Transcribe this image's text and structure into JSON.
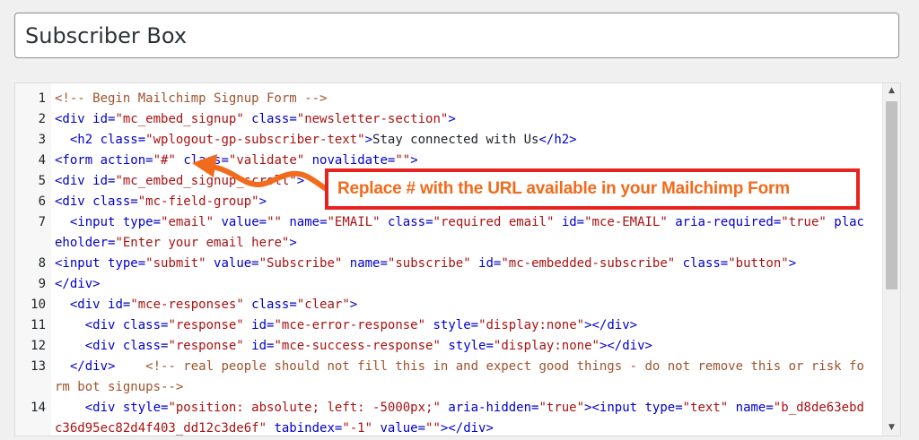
{
  "title_input": {
    "value": "Subscriber Box"
  },
  "editor": {
    "lines": [
      {
        "num": "1",
        "tokens": [
          {
            "c": "cmt",
            "t": "<!-- Begin Mailchimp Signup Form -->"
          }
        ]
      },
      {
        "num": "2",
        "tokens": [
          {
            "c": "tag",
            "t": "<div "
          },
          {
            "c": "attr",
            "t": "id="
          },
          {
            "c": "str",
            "t": "\"mc_embed_signup\""
          },
          {
            "c": "attr",
            "t": " class="
          },
          {
            "c": "str",
            "t": "\"newsletter-section\""
          },
          {
            "c": "tag",
            "t": ">"
          }
        ]
      },
      {
        "num": "3",
        "tokens": [
          {
            "c": "tag",
            "t": "  <h2 "
          },
          {
            "c": "attr",
            "t": "class="
          },
          {
            "c": "str",
            "t": "\"wplogout-gp-subscriber-text\""
          },
          {
            "c": "tag",
            "t": ">"
          },
          {
            "c": "text",
            "t": "Stay connected with Us"
          },
          {
            "c": "tag",
            "t": "</h2>"
          }
        ]
      },
      {
        "num": "4",
        "tokens": [
          {
            "c": "tag",
            "t": "<form "
          },
          {
            "c": "attr",
            "t": "action="
          },
          {
            "c": "str",
            "t": "\"#\""
          },
          {
            "c": "attr",
            "t": " class="
          },
          {
            "c": "str",
            "t": "\"validate\""
          },
          {
            "c": "attr",
            "t": " novalidate="
          },
          {
            "c": "str",
            "t": "\"\""
          },
          {
            "c": "tag",
            "t": ">"
          }
        ]
      },
      {
        "num": "5",
        "tokens": [
          {
            "c": "tag",
            "t": "<div "
          },
          {
            "c": "attr",
            "t": "id="
          },
          {
            "c": "str",
            "t": "\"mc_embed_signup_scroll\""
          },
          {
            "c": "tag",
            "t": ">"
          }
        ]
      },
      {
        "num": "6",
        "tokens": [
          {
            "c": "tag",
            "t": "<div "
          },
          {
            "c": "attr",
            "t": "class="
          },
          {
            "c": "str",
            "t": "\"mc-field-group\""
          },
          {
            "c": "tag",
            "t": ">"
          }
        ]
      },
      {
        "num": "7",
        "tokens": [
          {
            "c": "tag",
            "t": "  <input "
          },
          {
            "c": "attr",
            "t": "type="
          },
          {
            "c": "str",
            "t": "\"email\""
          },
          {
            "c": "attr",
            "t": " value="
          },
          {
            "c": "str",
            "t": "\"\""
          },
          {
            "c": "attr",
            "t": " name="
          },
          {
            "c": "str",
            "t": "\"EMAIL\""
          },
          {
            "c": "attr",
            "t": " class="
          },
          {
            "c": "str",
            "t": "\"required email\""
          },
          {
            "c": "attr",
            "t": " id="
          },
          {
            "c": "str",
            "t": "\"mce-EMAIL\""
          },
          {
            "c": "attr",
            "t": " aria-required="
          },
          {
            "c": "str",
            "t": "\"true\""
          },
          {
            "c": "attr",
            "t": " placeholder="
          },
          {
            "c": "str",
            "t": "\"Enter your email here\""
          },
          {
            "c": "tag",
            "t": ">"
          }
        ]
      },
      {
        "num": "8",
        "tokens": [
          {
            "c": "tag",
            "t": "<input "
          },
          {
            "c": "attr",
            "t": "type="
          },
          {
            "c": "str",
            "t": "\"submit\""
          },
          {
            "c": "attr",
            "t": " value="
          },
          {
            "c": "str",
            "t": "\"Subscribe\""
          },
          {
            "c": "attr",
            "t": " name="
          },
          {
            "c": "str",
            "t": "\"subscribe\""
          },
          {
            "c": "attr",
            "t": " id="
          },
          {
            "c": "str",
            "t": "\"mc-embedded-subscribe\""
          },
          {
            "c": "attr",
            "t": " class="
          },
          {
            "c": "str",
            "t": "\"button\""
          },
          {
            "c": "tag",
            "t": ">"
          }
        ]
      },
      {
        "num": "9",
        "tokens": [
          {
            "c": "tag",
            "t": "</div>"
          }
        ]
      },
      {
        "num": "10",
        "tokens": [
          {
            "c": "tag",
            "t": "  <div "
          },
          {
            "c": "attr",
            "t": "id="
          },
          {
            "c": "str",
            "t": "\"mce-responses\""
          },
          {
            "c": "attr",
            "t": " class="
          },
          {
            "c": "str",
            "t": "\"clear\""
          },
          {
            "c": "tag",
            "t": ">"
          }
        ]
      },
      {
        "num": "11",
        "tokens": [
          {
            "c": "tag",
            "t": "    <div "
          },
          {
            "c": "attr",
            "t": "class="
          },
          {
            "c": "str",
            "t": "\"response\""
          },
          {
            "c": "attr",
            "t": " id="
          },
          {
            "c": "str",
            "t": "\"mce-error-response\""
          },
          {
            "c": "attr",
            "t": " style="
          },
          {
            "c": "str",
            "t": "\"display:none\""
          },
          {
            "c": "tag",
            "t": "></div>"
          }
        ]
      },
      {
        "num": "12",
        "tokens": [
          {
            "c": "tag",
            "t": "    <div "
          },
          {
            "c": "attr",
            "t": "class="
          },
          {
            "c": "str",
            "t": "\"response\""
          },
          {
            "c": "attr",
            "t": " id="
          },
          {
            "c": "str",
            "t": "\"mce-success-response\""
          },
          {
            "c": "attr",
            "t": " style="
          },
          {
            "c": "str",
            "t": "\"display:none\""
          },
          {
            "c": "tag",
            "t": "></div>"
          }
        ]
      },
      {
        "num": "13",
        "tokens": [
          {
            "c": "tag",
            "t": "  </div>"
          },
          {
            "c": "text",
            "t": "    "
          },
          {
            "c": "cmt",
            "t": "<!-- real people should not fill this in and expect good things - do not remove this or risk form bot signups-->"
          }
        ]
      },
      {
        "num": "14",
        "tokens": [
          {
            "c": "tag",
            "t": "    <div "
          },
          {
            "c": "attr",
            "t": "style="
          },
          {
            "c": "str",
            "t": "\"position: absolute; left: -5000px;\""
          },
          {
            "c": "attr",
            "t": " aria-hidden="
          },
          {
            "c": "str",
            "t": "\"true\""
          },
          {
            "c": "tag",
            "t": "><input "
          },
          {
            "c": "attr",
            "t": "type="
          },
          {
            "c": "str",
            "t": "\"text\""
          },
          {
            "c": "attr",
            "t": " name="
          },
          {
            "c": "str",
            "t": "\"b_d8de63ebdc36d95ec82d4f403_dd12c3de6f\""
          },
          {
            "c": "attr",
            "t": " tabindex="
          },
          {
            "c": "str",
            "t": "\"-1\""
          },
          {
            "c": "attr",
            "t": " value="
          },
          {
            "c": "str",
            "t": "\"\""
          },
          {
            "c": "tag",
            "t": "></div>"
          }
        ]
      }
    ]
  },
  "scrollbar": {
    "up_glyph": "▲",
    "down_glyph": "▼"
  },
  "annotation": {
    "text": "Replace # with the URL available in your Mailchimp Form",
    "colors": {
      "border": "#e8231f",
      "text": "#f26a1b",
      "arrow": "#f26a1b"
    }
  }
}
